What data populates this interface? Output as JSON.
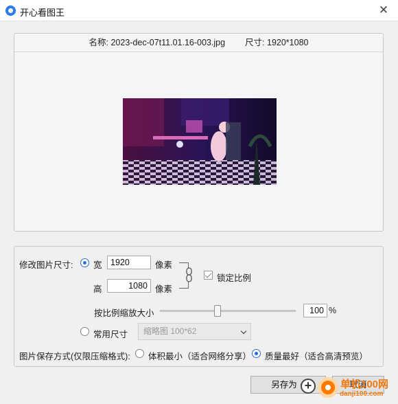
{
  "window": {
    "title": "开心看图王",
    "close_glyph": "✕"
  },
  "preview": {
    "name_label": "名称:",
    "file_name": "2023-dec-07t11.01.16-003.jpg",
    "size_label": "尺寸:",
    "size_value": "1920*1080"
  },
  "resize": {
    "section_label": "修改图片尺寸:",
    "width_label": "宽",
    "width_value": "1920",
    "height_label": "高",
    "height_value": "1080",
    "unit": "像素",
    "lock_ratio_label": "锁定比例",
    "lock_ratio_checked": true,
    "scale_label": "按比例缩放大小",
    "scale_value": "100",
    "scale_unit": "%",
    "slider_level_percent": 41,
    "common_size_label": "常用尺寸",
    "common_size_selected": "缩略图 100*62"
  },
  "save_mode": {
    "label": "图片保存方式(仅限压缩格式):",
    "option_small": "体积最小（适合网络分享）",
    "option_quality": "质量最好（适合高清预览）",
    "selected": "quality"
  },
  "buttons": {
    "save_as": "另存为",
    "cancel": "取消"
  },
  "watermark": {
    "brand": "单机100网",
    "domain": "danji100.com"
  },
  "colors": {
    "accent": "#2a6fd6",
    "watermark": "#f07a12"
  }
}
